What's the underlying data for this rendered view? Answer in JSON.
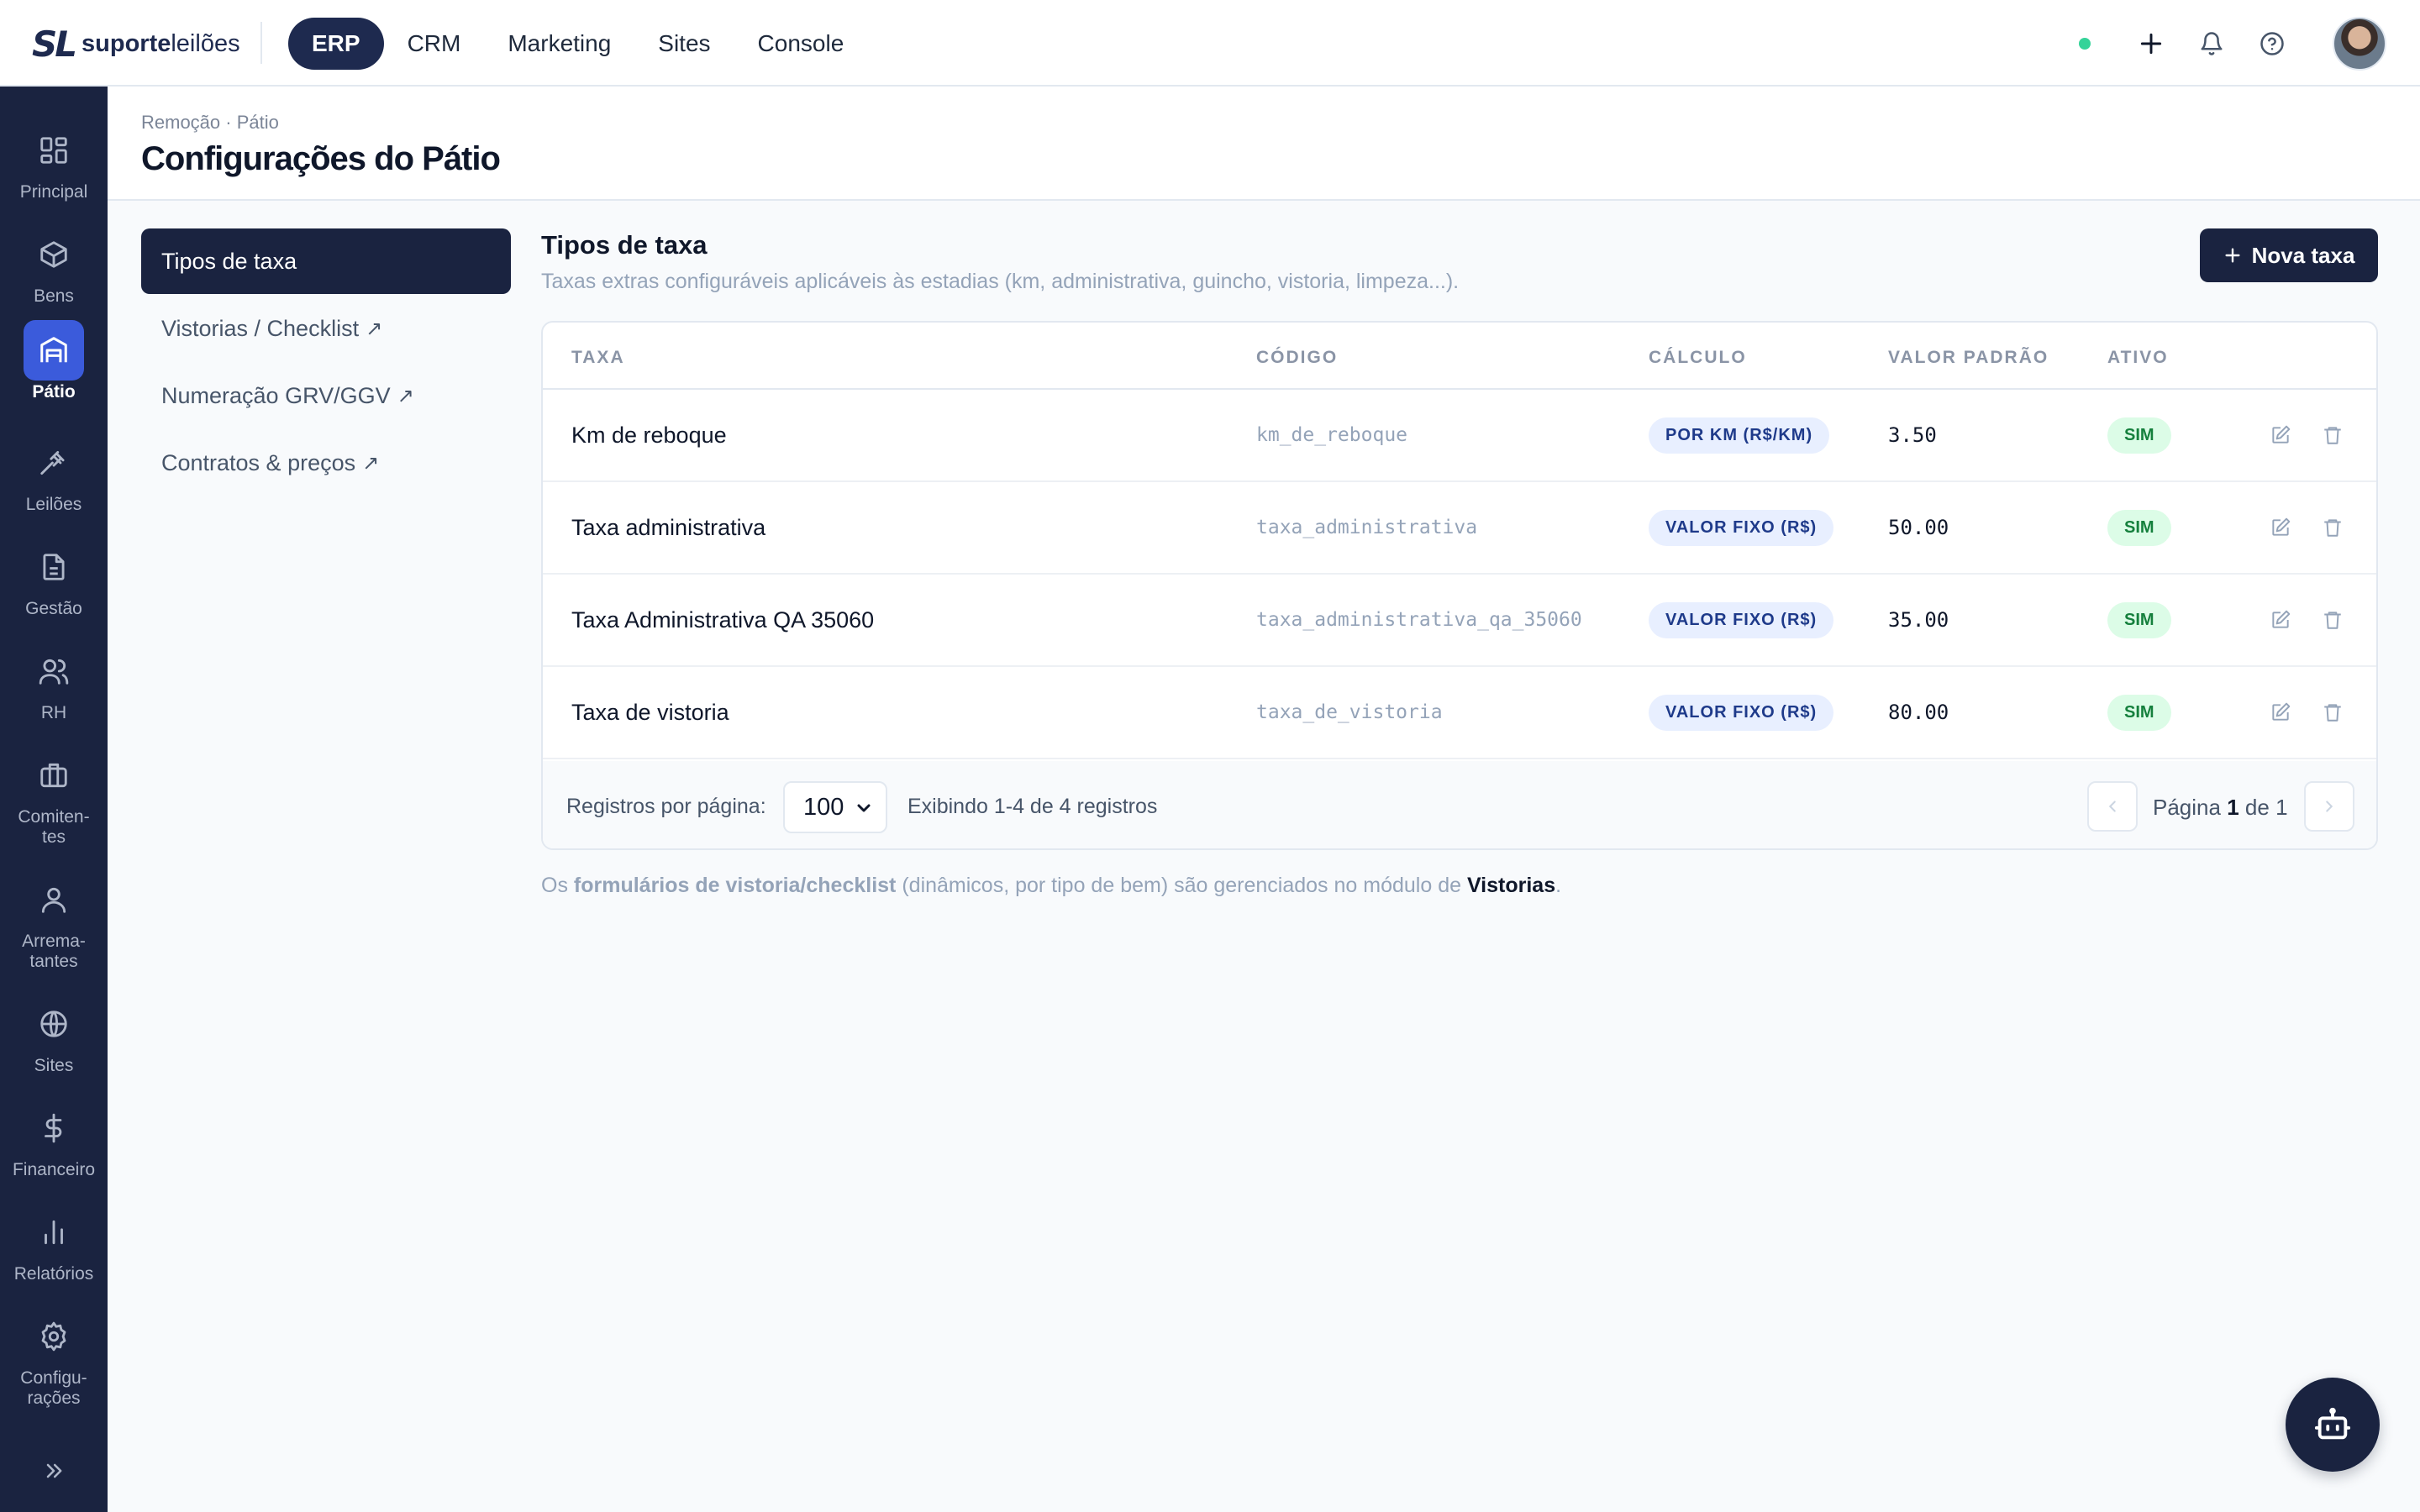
{
  "brand": {
    "mark": "SL",
    "name_bold": "suporte",
    "name_light": "leilões"
  },
  "topnav": [
    {
      "label": "ERP",
      "active": true
    },
    {
      "label": "CRM",
      "active": false
    },
    {
      "label": "Marketing",
      "active": false
    },
    {
      "label": "Sites",
      "active": false
    },
    {
      "label": "Console",
      "active": false
    }
  ],
  "topbar_icons": [
    "status-online-dot",
    "plus-icon",
    "bell-icon",
    "help-icon",
    "user-avatar"
  ],
  "sidebar": {
    "items": [
      {
        "label": "Principal",
        "icon": "dashboard-icon",
        "active": false
      },
      {
        "label": "Bens",
        "icon": "box-icon",
        "active": false
      },
      {
        "label": "Pátio",
        "icon": "warehouse-icon",
        "active": true
      },
      {
        "label": "Leilões",
        "icon": "gavel-icon",
        "active": false
      },
      {
        "label": "Gestão",
        "icon": "document-icon",
        "active": false
      },
      {
        "label": "RH",
        "icon": "users-icon",
        "active": false
      },
      {
        "label": "Comiten-\ntes",
        "icon": "briefcase-icon",
        "active": false
      },
      {
        "label": "Arrema-\ntantes",
        "icon": "user-icon",
        "active": false
      },
      {
        "label": "Sites",
        "icon": "globe-icon",
        "active": false
      },
      {
        "label": "Financeiro",
        "icon": "dollar-icon",
        "active": false
      },
      {
        "label": "Relatórios",
        "icon": "bar-chart-icon",
        "active": false
      },
      {
        "label": "Configu-\nrações",
        "icon": "gear-icon",
        "active": false
      }
    ],
    "expand_icon": "chevrons-right-icon"
  },
  "header": {
    "breadcrumb": "Remoção · Pátio",
    "title": "Configurações do Pátio"
  },
  "settings_nav": [
    {
      "label": "Tipos de taxa",
      "active": true,
      "external": false
    },
    {
      "label": "Vistorias / Checklist",
      "active": false,
      "external": true
    },
    {
      "label": "Numeração GRV/GGV",
      "active": false,
      "external": true
    },
    {
      "label": "Contratos & preços",
      "active": false,
      "external": true
    }
  ],
  "section": {
    "title": "Tipos de taxa",
    "subtitle": "Taxas extras configuráveis aplicáveis às estadias (km, administrativa, guincho, vistoria, limpeza...).",
    "new_button": "Nova taxa"
  },
  "table": {
    "columns": [
      "TAXA",
      "CÓDIGO",
      "CÁLCULO",
      "VALOR PADRÃO",
      "ATIVO"
    ],
    "rows": [
      {
        "taxa": "Km de reboque",
        "codigo": "km_de_reboque",
        "calculo": "POR KM (R$/KM)",
        "valor": "3.50",
        "ativo": "SIM"
      },
      {
        "taxa": "Taxa administrativa",
        "codigo": "taxa_administrativa",
        "calculo": "VALOR FIXO (R$)",
        "valor": "50.00",
        "ativo": "SIM"
      },
      {
        "taxa": "Taxa Administrativa QA 35060",
        "codigo": "taxa_administrativa_qa_35060",
        "calculo": "VALOR FIXO (R$)",
        "valor": "35.00",
        "ativo": "SIM"
      },
      {
        "taxa": "Taxa de vistoria",
        "codigo": "taxa_de_vistoria",
        "calculo": "VALOR FIXO (R$)",
        "valor": "80.00",
        "ativo": "SIM"
      }
    ],
    "row_actions": [
      "edit-icon",
      "trash-icon"
    ]
  },
  "footer": {
    "per_page_label": "Registros por página:",
    "per_page_value": "100",
    "showing": "Exibindo 1-4 de 4 registros",
    "page_prefix": "Página",
    "page_current": "1",
    "page_of": "de",
    "page_total": "1"
  },
  "footnote": {
    "pre": "Os ",
    "strong": "formulários de vistoria/checklist",
    "mid": " (dinâmicos, por tipo de bem) são gerenciados no módulo de ",
    "link": "Vistorias",
    "post": "."
  },
  "fab_icon": "bot-icon",
  "colors": {
    "navy": "#1a2340",
    "accent_blue": "#3b5bdb",
    "status_green": "#34d399",
    "badge_blue_bg": "#e8efff",
    "badge_green_bg": "#dcfce7"
  }
}
